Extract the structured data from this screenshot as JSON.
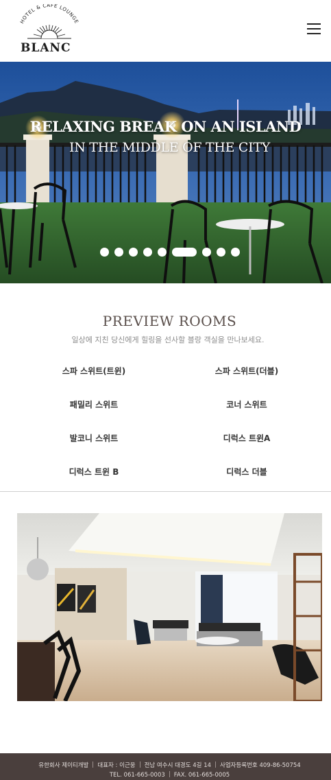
{
  "header": {
    "logo_arc_text": "HOTEL & CAFE LOUNGE",
    "logo_name": "BLANC"
  },
  "hero": {
    "line1": "RELAXING BREAK ON AN ISLAND",
    "line2": "IN THE MIDDLE OF THE CITY",
    "slide_count": 9,
    "active_slide": 6
  },
  "preview": {
    "title": "PREVIEW ROOMS",
    "subtitle": "일상에 지친 당신에게 힐링을 선사할 블랑 객실을 만나보세요.",
    "rooms": [
      "스파 스위트(트윈)",
      "스파 스위트(더블)",
      "패밀리 스위트",
      "코너 스위트",
      "발코니 스위트",
      "디럭스 트윈A",
      "디럭스 트윈 B",
      "디럭스 더블"
    ]
  },
  "footer": {
    "company": "유한회사 제이티개발",
    "ceo": "대표자 : 이근웅",
    "address": "전남 여수시 대경도 4길 14",
    "business_no": "사업자등록번호 409-86-50754",
    "tel": "TEL. 061-665-0003",
    "fax": "FAX. 061-665-0005"
  },
  "colors": {
    "footer_bg": "#4a3f3d",
    "title": "#5a4f4b"
  }
}
